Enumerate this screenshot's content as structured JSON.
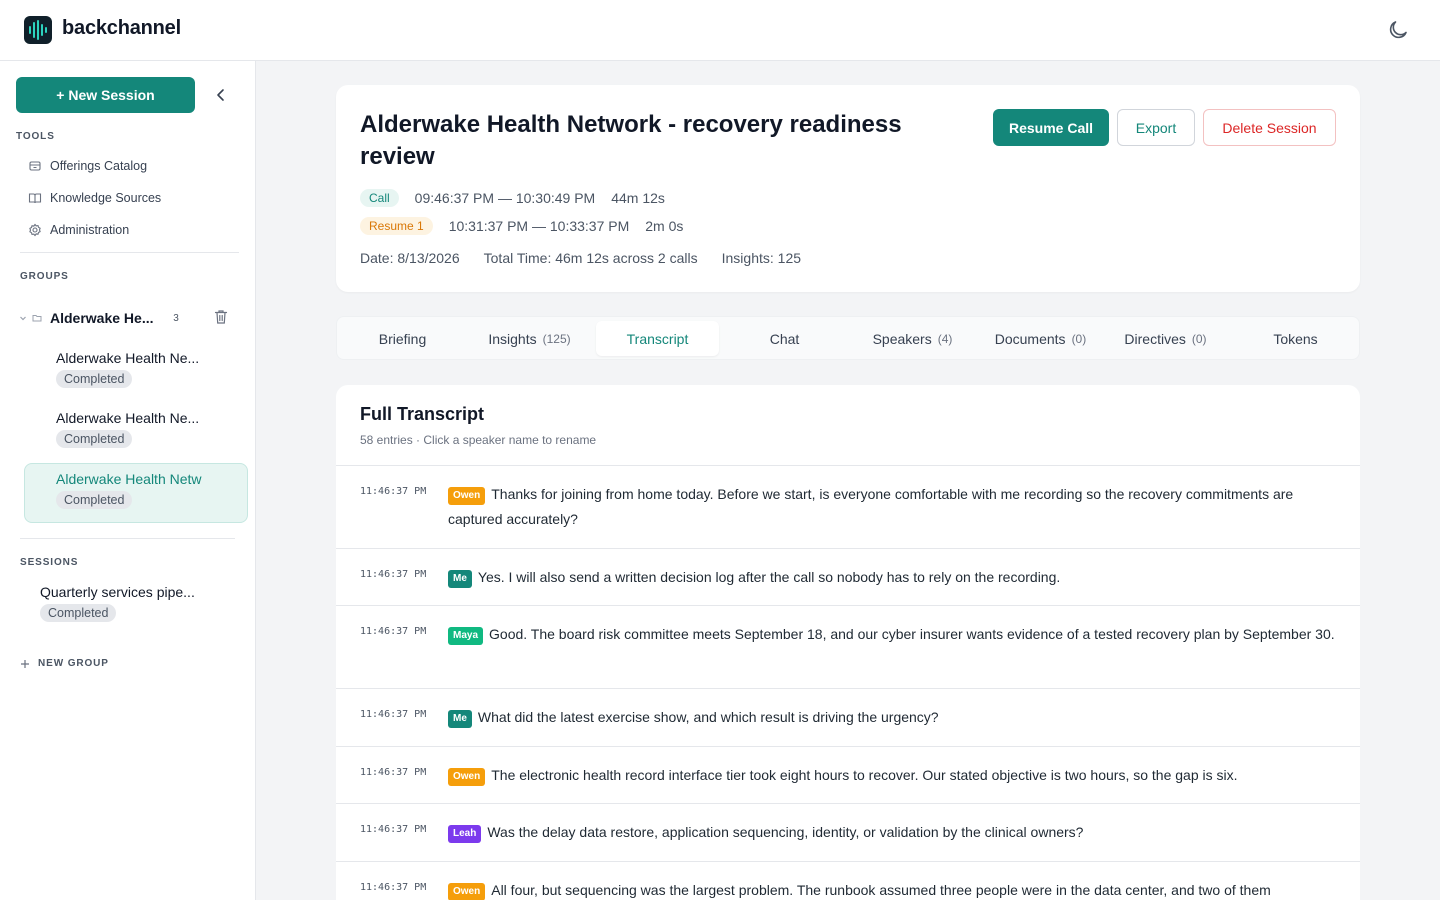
{
  "app": {
    "brand": "backchannel"
  },
  "sidebar": {
    "new_session_label": "+ New Session",
    "tools_label": "TOOLS",
    "tools": [
      {
        "label": "Offerings Catalog",
        "icon": "box-icon"
      },
      {
        "label": "Knowledge Sources",
        "icon": "book-icon"
      },
      {
        "label": "Administration",
        "icon": "gear-icon"
      }
    ],
    "groups_label": "GROUPS",
    "group": {
      "name": "Alderwake He...",
      "count": "3",
      "items": [
        {
          "title": "Alderwake Health Ne...",
          "status": "Completed"
        },
        {
          "title": "Alderwake Health Ne...",
          "status": "Completed"
        },
        {
          "title": "Alderwake Health Netw",
          "status": "Completed"
        }
      ]
    },
    "sessions_label": "SESSIONS",
    "sessions": [
      {
        "title": "Quarterly services pipe...",
        "status": "Completed"
      }
    ],
    "new_group_label": "NEW GROUP"
  },
  "header": {
    "title": "Alderwake Health Network - recovery readiness review",
    "buttons": {
      "resume": "Resume Call",
      "export": "Export",
      "delete": "Delete Session"
    },
    "calls": [
      {
        "tag": "Call",
        "range": "09:46:37 PM — 10:30:49 PM",
        "duration": "44m 12s"
      },
      {
        "tag": "Resume 1",
        "range": "10:31:37 PM — 10:33:37 PM",
        "duration": "2m 0s"
      }
    ],
    "stats": {
      "date": "Date: 8/13/2026",
      "total": "Total Time: 46m 12s across 2 calls",
      "insights": "Insights: 125"
    }
  },
  "tabs": [
    {
      "label": "Briefing",
      "count": ""
    },
    {
      "label": "Insights",
      "count": "(125)"
    },
    {
      "label": "Transcript",
      "count": ""
    },
    {
      "label": "Chat",
      "count": ""
    },
    {
      "label": "Speakers",
      "count": "(4)"
    },
    {
      "label": "Documents",
      "count": "(0)"
    },
    {
      "label": "Directives",
      "count": "(0)"
    },
    {
      "label": "Tokens",
      "count": ""
    }
  ],
  "transcript": {
    "title": "Full Transcript",
    "subtitle": "58 entries · Click a speaker name to rename",
    "entries": [
      {
        "time": "11:46:37 PM",
        "speaker": "Owen",
        "text": "Thanks for joining from home today. Before we start, is everyone comfortable with me recording so the recovery commitments are captured accurately?"
      },
      {
        "time": "11:46:37 PM",
        "speaker": "Me",
        "text": "Yes. I will also send a written decision log after the call so nobody has to rely on the recording."
      },
      {
        "time": "11:46:37 PM",
        "speaker": "Maya",
        "text": "Good. The board risk committee meets September 18, and our cyber insurer wants evidence of a tested recovery plan by September 30."
      },
      {
        "time": "11:46:37 PM",
        "speaker": "Me",
        "text": "What did the latest exercise show, and which result is driving the urgency?"
      },
      {
        "time": "11:46:37 PM",
        "speaker": "Owen",
        "text": "The electronic health record interface tier took eight hours to recover. Our stated objective is two hours, so the gap is six."
      },
      {
        "time": "11:46:37 PM",
        "speaker": "Leah",
        "text": "Was the delay data restore, application sequencing, identity, or validation by the clinical owners?"
      },
      {
        "time": "11:46:37 PM",
        "speaker": "Owen",
        "text": "All four, but sequencing was the largest problem. The runbook assumed three people were in the data center, and two of them"
      }
    ]
  }
}
